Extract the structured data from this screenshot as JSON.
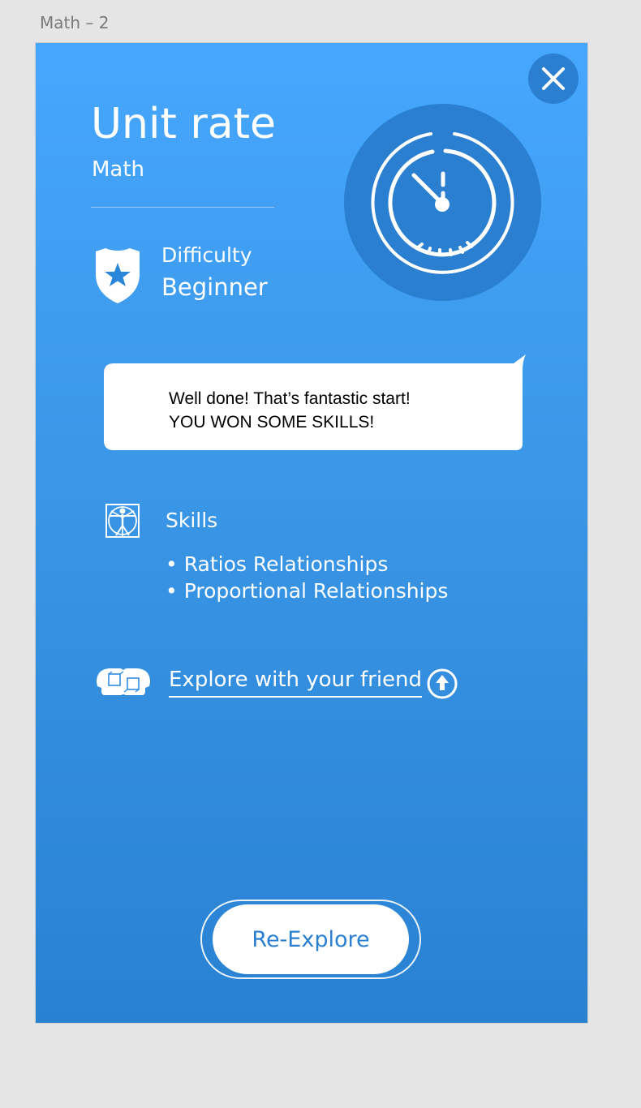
{
  "frame": {
    "label": "Math – 2"
  },
  "lesson": {
    "title": "Unit rate",
    "subject": "Math"
  },
  "difficulty": {
    "label": "Difficulty",
    "value": "Beginner"
  },
  "message": {
    "line1": "Well done! That’s fantastic start!",
    "line2": "YOU WON SOME SKILLS!"
  },
  "skills": {
    "label": "Skills",
    "items": [
      "Ratios Relationships",
      "Proportional Relationships"
    ]
  },
  "explore": {
    "link_label": "Explore with your friend"
  },
  "actions": {
    "re_explore_label": "Re-Explore"
  },
  "icons": {
    "close": "close-icon",
    "timer": "stopwatch-icon",
    "difficulty": "shield-star-icon",
    "skills": "vitruvian-man-icon",
    "friends": "friends-cubes-icon",
    "share": "upload-icon"
  },
  "colors": {
    "background_top": "#46a7fe",
    "background_bottom": "#2981d2",
    "accent_dark": "#2a7fd0",
    "text": "#ffffff"
  }
}
